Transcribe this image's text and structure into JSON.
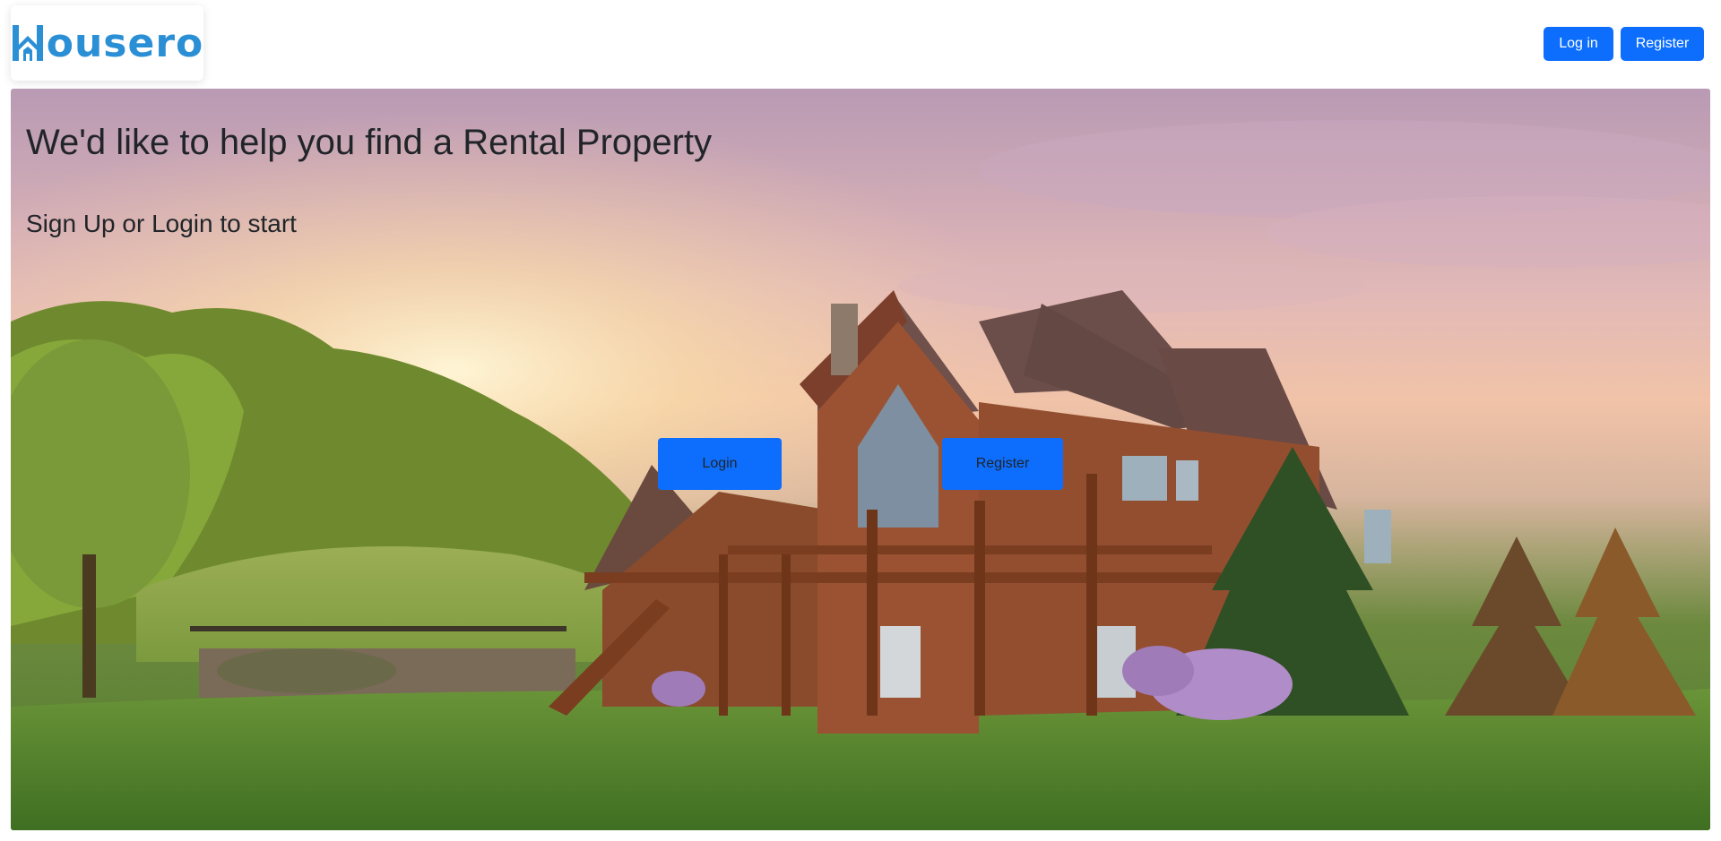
{
  "brand": {
    "name": "ousero",
    "logo_icon": "house-h-icon",
    "color": "#2b8fd6"
  },
  "nav": {
    "login_label": "Log in",
    "register_label": "Register"
  },
  "hero": {
    "title": "We'd like to help you find a Rental Property",
    "subtitle": "Sign Up or Login to start",
    "login_label": "Login",
    "register_label": "Register"
  },
  "colors": {
    "primary": "#0d6efd",
    "text": "#212529"
  }
}
